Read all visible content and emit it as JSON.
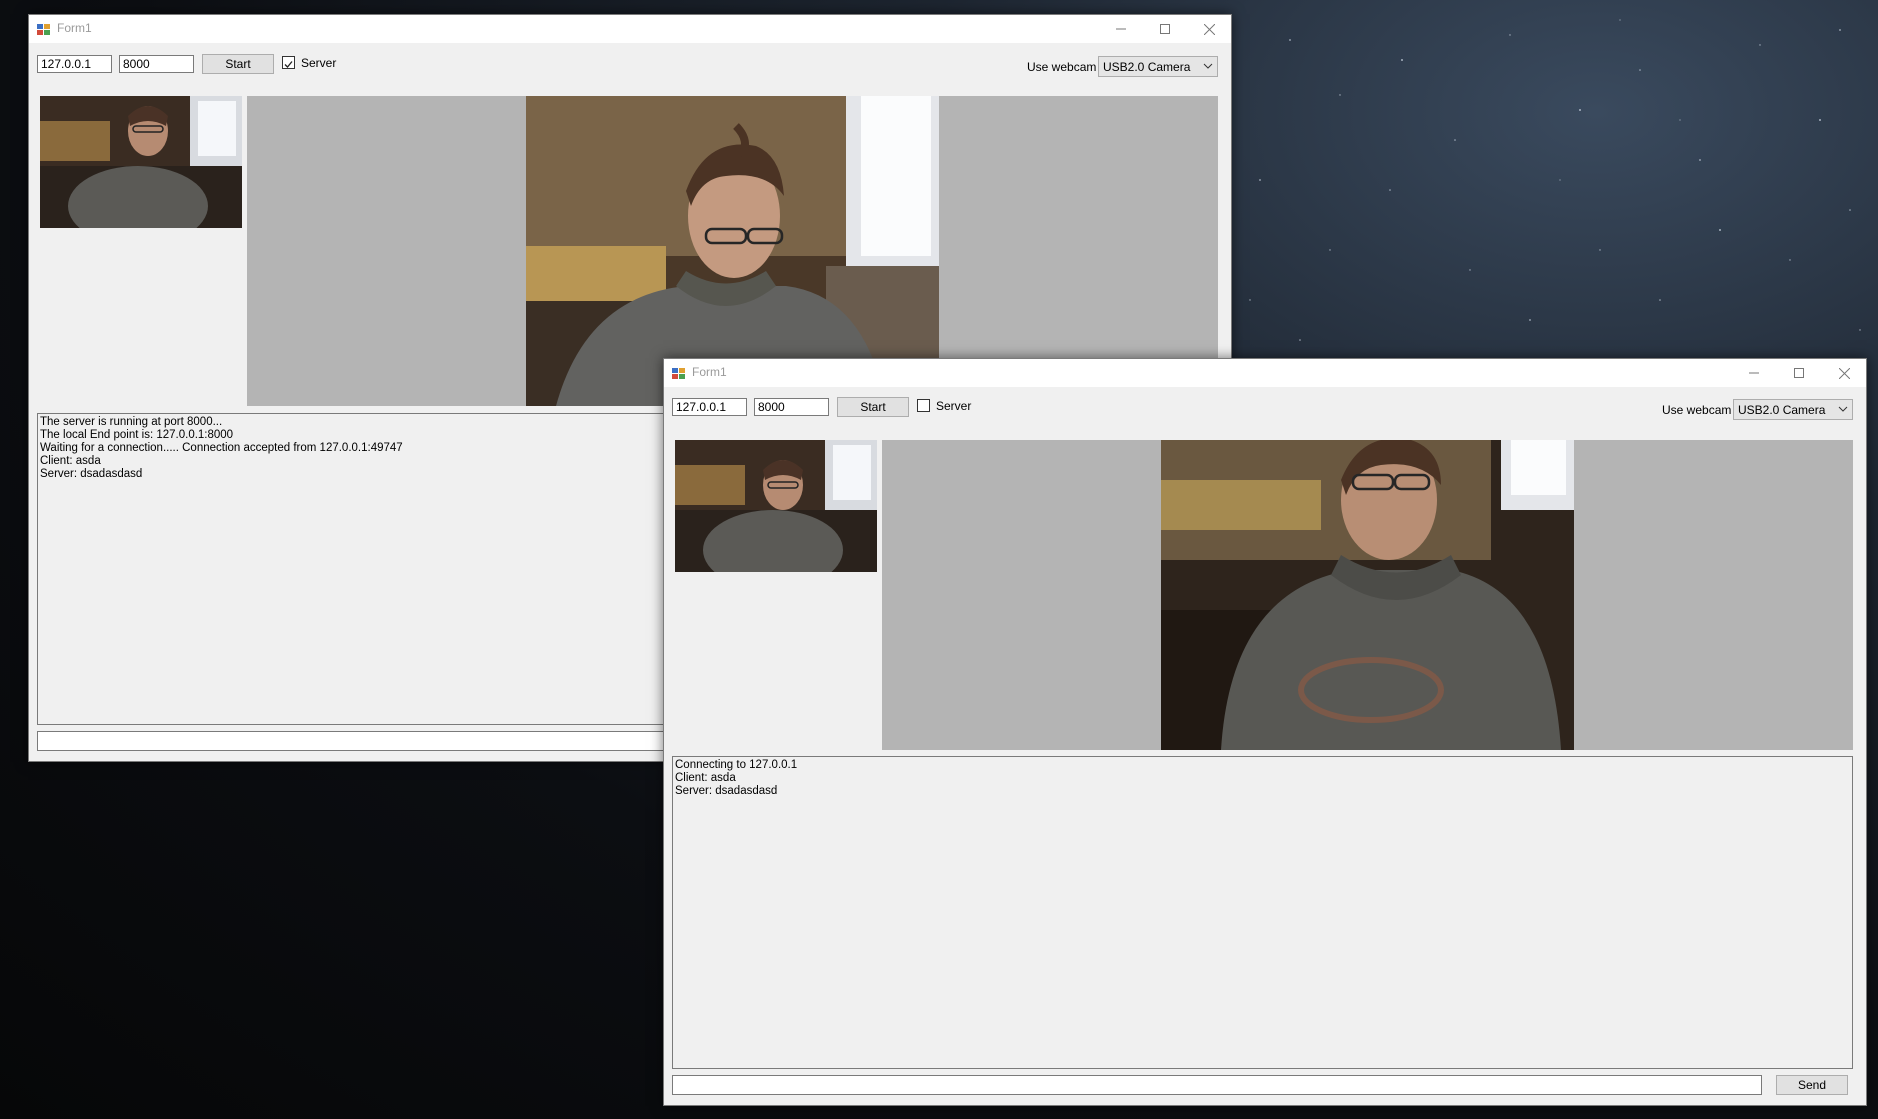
{
  "desktop": {
    "background": "night sky wallpaper"
  },
  "windows": [
    {
      "title": "Form1",
      "ip_value": "127.0.0.1",
      "port_value": "8000",
      "start_label": "Start",
      "server_label": "Server",
      "server_checked": true,
      "webcam_label": "Use webcam",
      "webcam_selected": "USB2.0 Camera",
      "log_lines": [
        "The server is running at port 8000...",
        "The local End point is: 127.0.0.1:8000",
        "Waiting for a connection.....  Connection accepted from 127.0.0.1:49747",
        "Client: asda",
        "Server: dsadasdasd"
      ]
    },
    {
      "title": "Form1",
      "ip_value": "127.0.0.1",
      "port_value": "8000",
      "start_label": "Start",
      "server_label": "Server",
      "server_checked": false,
      "webcam_label": "Use webcam",
      "webcam_selected": "USB2.0 Camera",
      "log_lines": [
        "Connecting to 127.0.0.1",
        "Client: asda",
        "Server: dsadasdasd"
      ],
      "message_value": "",
      "send_label": "Send"
    }
  ],
  "colors": {
    "window_bg": "#f0f0f0",
    "video_letterbox": "#b4b4b4",
    "titlebar_text": "#9a9a9a"
  }
}
